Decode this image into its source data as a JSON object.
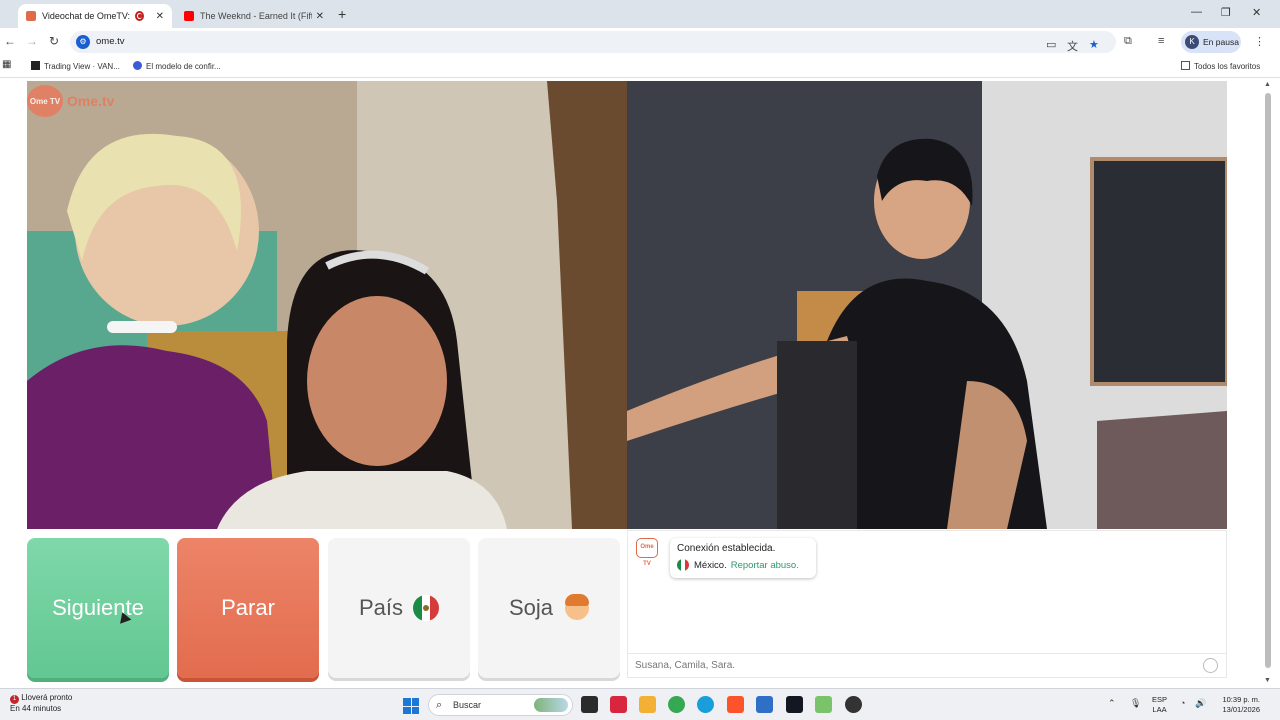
{
  "browser": {
    "tabs": [
      {
        "title": "Videochat de OmeTV: una ...",
        "active": true,
        "favicon_color": "#e06a4c"
      },
      {
        "title": "The Weeknd - Earned It (Fifty Sh...",
        "active": false,
        "favicon_color": "#ff0000"
      }
    ],
    "new_tab": "+",
    "url": "ome.tv",
    "profile_initial": "K",
    "profile_status": "En pausa",
    "bookmarks": [
      {
        "label": "Trading View · VAN..."
      },
      {
        "label": "El modelo de confir..."
      }
    ],
    "all_bookmarks": "Todos los favoritos"
  },
  "ometv": {
    "logo_text": "Ome.tv",
    "logo_badge": "Ome TV",
    "buttons": {
      "next": "Siguiente",
      "stop": "Parar",
      "country": "País",
      "gender": "Soja"
    },
    "chat": {
      "badge": "Ome TV",
      "connection_message": "Conexión establecida.",
      "country": "México",
      "report_link": "Reportar abuso.",
      "input_text": "Susana, Camila, Sara."
    },
    "colors": {
      "next": "#62c792",
      "stop": "#e36c4e",
      "brand": "#e06a4c",
      "link": "#2f9a6a"
    }
  },
  "taskbar": {
    "weather_line1": "Lloverá pronto",
    "weather_line2": "En 44 minutos",
    "weather_badge": "1",
    "search_placeholder": "Buscar",
    "lang_line1": "ESP",
    "lang_line2": "LAA",
    "time": "10:39 p. m.",
    "date": "13/01/2026"
  }
}
